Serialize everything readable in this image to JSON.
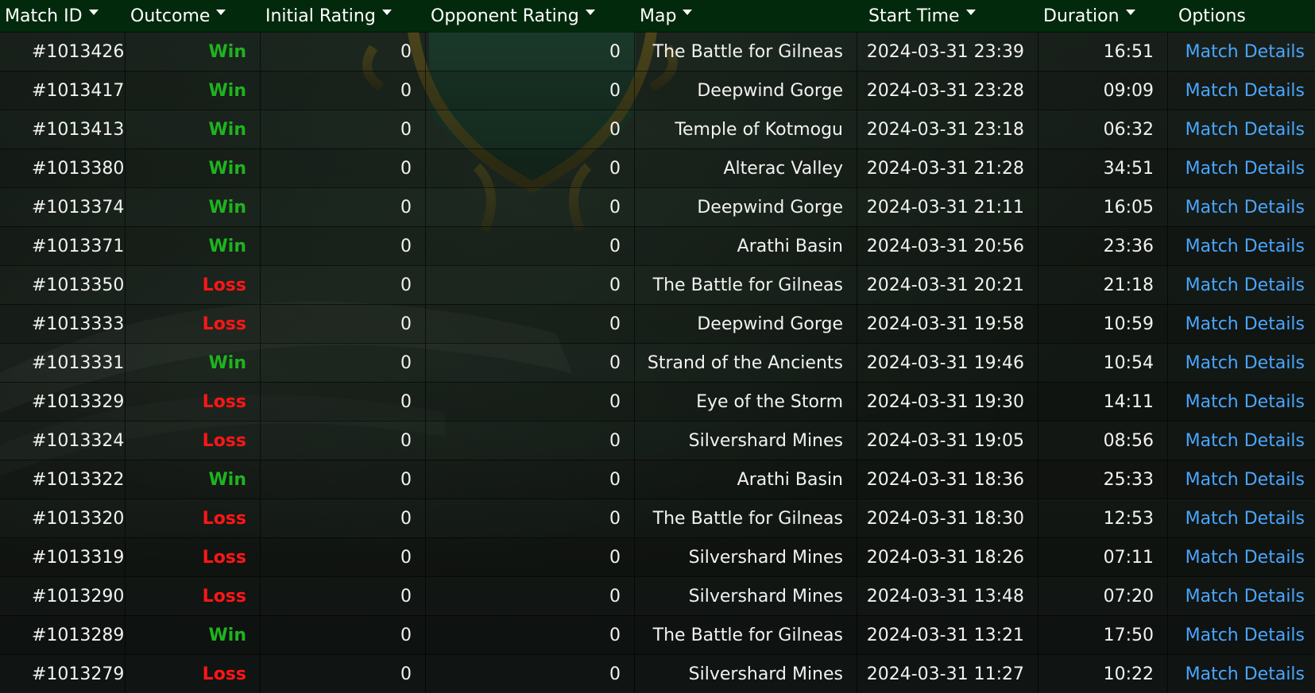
{
  "headers": {
    "match_id": "Match ID",
    "outcome": "Outcome",
    "initial_rating": "Initial Rating",
    "opponent_rating": "Opponent Rating",
    "map": "Map",
    "start_time": "Start Time",
    "duration": "Duration",
    "options": "Options"
  },
  "colors": {
    "win": "#1fb31f",
    "loss": "#ff1616",
    "link": "#4aa6ff",
    "header_bg": "#02290c"
  },
  "rows": [
    {
      "id": "#1013426",
      "outcome": "Win",
      "initial_rating": "0",
      "opponent_rating": "0",
      "map": "The Battle for Gilneas",
      "start_time": "2024-03-31 23:39",
      "duration": "16:51",
      "option": "Match Details"
    },
    {
      "id": "#1013417",
      "outcome": "Win",
      "initial_rating": "0",
      "opponent_rating": "0",
      "map": "Deepwind Gorge",
      "start_time": "2024-03-31 23:28",
      "duration": "09:09",
      "option": "Match Details"
    },
    {
      "id": "#1013413",
      "outcome": "Win",
      "initial_rating": "0",
      "opponent_rating": "0",
      "map": "Temple of Kotmogu",
      "start_time": "2024-03-31 23:18",
      "duration": "06:32",
      "option": "Match Details"
    },
    {
      "id": "#1013380",
      "outcome": "Win",
      "initial_rating": "0",
      "opponent_rating": "0",
      "map": "Alterac Valley",
      "start_time": "2024-03-31 21:28",
      "duration": "34:51",
      "option": "Match Details"
    },
    {
      "id": "#1013374",
      "outcome": "Win",
      "initial_rating": "0",
      "opponent_rating": "0",
      "map": "Deepwind Gorge",
      "start_time": "2024-03-31 21:11",
      "duration": "16:05",
      "option": "Match Details"
    },
    {
      "id": "#1013371",
      "outcome": "Win",
      "initial_rating": "0",
      "opponent_rating": "0",
      "map": "Arathi Basin",
      "start_time": "2024-03-31 20:56",
      "duration": "23:36",
      "option": "Match Details"
    },
    {
      "id": "#1013350",
      "outcome": "Loss",
      "initial_rating": "0",
      "opponent_rating": "0",
      "map": "The Battle for Gilneas",
      "start_time": "2024-03-31 20:21",
      "duration": "21:18",
      "option": "Match Details"
    },
    {
      "id": "#1013333",
      "outcome": "Loss",
      "initial_rating": "0",
      "opponent_rating": "0",
      "map": "Deepwind Gorge",
      "start_time": "2024-03-31 19:58",
      "duration": "10:59",
      "option": "Match Details"
    },
    {
      "id": "#1013331",
      "outcome": "Win",
      "initial_rating": "0",
      "opponent_rating": "0",
      "map": "Strand of the Ancients",
      "start_time": "2024-03-31 19:46",
      "duration": "10:54",
      "option": "Match Details"
    },
    {
      "id": "#1013329",
      "outcome": "Loss",
      "initial_rating": "0",
      "opponent_rating": "0",
      "map": "Eye of the Storm",
      "start_time": "2024-03-31 19:30",
      "duration": "14:11",
      "option": "Match Details"
    },
    {
      "id": "#1013324",
      "outcome": "Loss",
      "initial_rating": "0",
      "opponent_rating": "0",
      "map": "Silvershard Mines",
      "start_time": "2024-03-31 19:05",
      "duration": "08:56",
      "option": "Match Details"
    },
    {
      "id": "#1013322",
      "outcome": "Win",
      "initial_rating": "0",
      "opponent_rating": "0",
      "map": "Arathi Basin",
      "start_time": "2024-03-31 18:36",
      "duration": "25:33",
      "option": "Match Details"
    },
    {
      "id": "#1013320",
      "outcome": "Loss",
      "initial_rating": "0",
      "opponent_rating": "0",
      "map": "The Battle for Gilneas",
      "start_time": "2024-03-31 18:30",
      "duration": "12:53",
      "option": "Match Details"
    },
    {
      "id": "#1013319",
      "outcome": "Loss",
      "initial_rating": "0",
      "opponent_rating": "0",
      "map": "Silvershard Mines",
      "start_time": "2024-03-31 18:26",
      "duration": "07:11",
      "option": "Match Details"
    },
    {
      "id": "#1013290",
      "outcome": "Loss",
      "initial_rating": "0",
      "opponent_rating": "0",
      "map": "Silvershard Mines",
      "start_time": "2024-03-31 13:48",
      "duration": "07:20",
      "option": "Match Details"
    },
    {
      "id": "#1013289",
      "outcome": "Win",
      "initial_rating": "0",
      "opponent_rating": "0",
      "map": "The Battle for Gilneas",
      "start_time": "2024-03-31 13:21",
      "duration": "17:50",
      "option": "Match Details"
    },
    {
      "id": "#1013279",
      "outcome": "Loss",
      "initial_rating": "0",
      "opponent_rating": "0",
      "map": "Silvershard Mines",
      "start_time": "2024-03-31 11:27",
      "duration": "10:22",
      "option": "Match Details"
    }
  ]
}
